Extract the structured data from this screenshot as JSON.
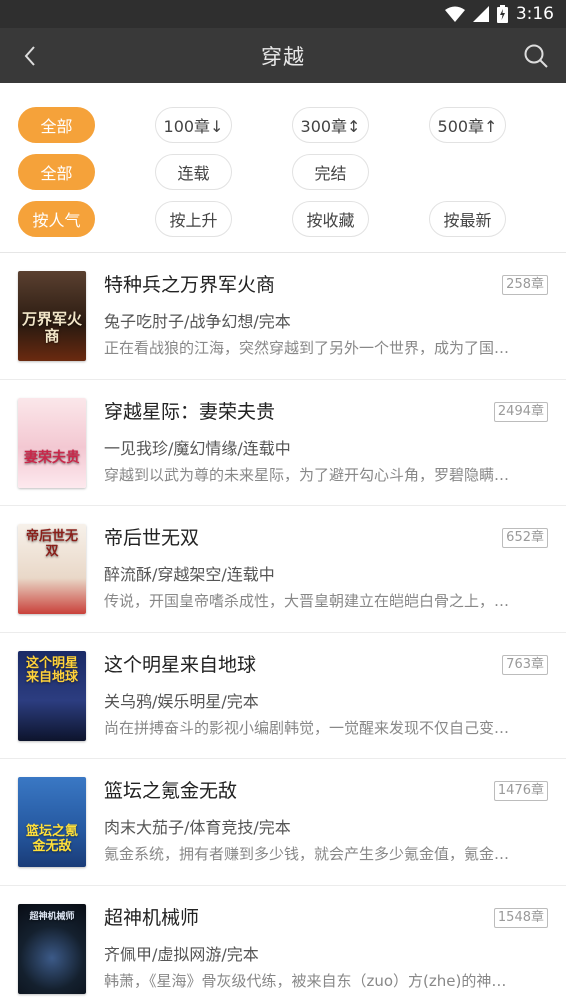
{
  "status": {
    "time": "3:16"
  },
  "header": {
    "title": "穿越"
  },
  "filters": {
    "length": [
      "全部",
      "100章↓",
      "300章↕",
      "500章↑"
    ],
    "status": [
      "全部",
      "连载",
      "完结"
    ],
    "sort": [
      "按人气",
      "按上升",
      "按收藏",
      "按最新"
    ]
  },
  "books": [
    {
      "title": "特种兵之万界军火商",
      "meta": "兔子吃肘子/战争幻想/完本",
      "desc": "正在看战狼的江海，突然穿越到了另外一个世界，成为了国…",
      "chapters": "258章",
      "cover_text": "万界军火商",
      "cover_color": "#3a2a1c"
    },
    {
      "title": "穿越星际：妻荣夫贵",
      "meta": "一见我珍/魔幻情缘/连载中",
      "desc": "穿越到以武为尊的未来星际，为了避开勾心斗角，罗碧隐瞒…",
      "chapters": "2494章",
      "cover_text": "妻荣夫贵",
      "cover_color": "#f6d7de"
    },
    {
      "title": "帝后世无双",
      "meta": "醉流酥/穿越架空/连载中",
      "desc": "传说，开国皇帝嗜杀成性，大晋皇朝建立在皑皑白骨之上，…",
      "chapters": "652章",
      "cover_text": "帝后世无双",
      "cover_color": "#f3ece4"
    },
    {
      "title": "这个明星来自地球",
      "meta": "关乌鸦/娱乐明星/完本",
      "desc": "尚在拼搏奋斗的影视小编剧韩觉，一觉醒来发现不仅自己变…",
      "chapters": "763章",
      "cover_text": "这个明星来自地球",
      "cover_color": "#1d2b5a"
    },
    {
      "title": "篮坛之氪金无敌",
      "meta": "肉末大茄子/体育竞技/完本",
      "desc": "氪金系统，拥有者赚到多少钱，就会产生多少氪金值，氪金…",
      "chapters": "1476章",
      "cover_text": "篮坛之氪金无敌",
      "cover_color": "#2a62a8"
    },
    {
      "title": "超神机械师",
      "meta": "齐佩甲/虚拟网游/完本",
      "desc": "韩萧，《星海》骨灰级代练，被来自东（zuo）方(zhe)的神…",
      "chapters": "1548章",
      "cover_text": "超神机械师",
      "cover_color": "#0e1420"
    }
  ]
}
